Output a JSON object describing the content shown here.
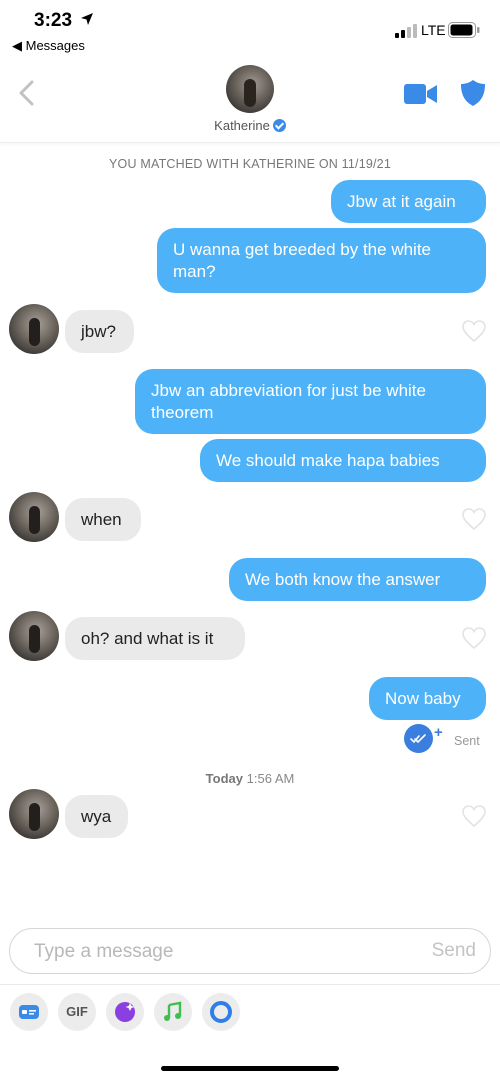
{
  "status_bar": {
    "time": "3:23",
    "back_app": "◀ Messages",
    "network": "LTE"
  },
  "header": {
    "name": "Katherine"
  },
  "matched_banner": "YOU MATCHED WITH KATHERINE ON 11/19/21",
  "messages": [
    {
      "text": "Jbw at it again"
    },
    {
      "text": "U wanna get breeded by the white man?"
    },
    {
      "text": "jbw?"
    },
    {
      "text": "Jbw an abbreviation for just be white theorem"
    },
    {
      "text": "We should make hapa babies"
    },
    {
      "text": "when"
    },
    {
      "text": "We both know the answer"
    },
    {
      "text": "oh? and what is it"
    },
    {
      "text": "Now baby"
    },
    {
      "text": "wya"
    }
  ],
  "receipt": {
    "plus": "+",
    "status": "Sent"
  },
  "timestamp": {
    "day": "Today",
    "time": "1:56 AM"
  },
  "composer": {
    "placeholder": "Type a message",
    "send_label": "Send"
  },
  "toolbar": {
    "gif_label": "GIF"
  },
  "colors": {
    "outgoing_bubble": "#4db2f7",
    "incoming_bubble": "#eaeaea",
    "accent_blue": "#3a8ae8"
  },
  "icons": [
    "location-arrow-icon",
    "signal-icon",
    "battery-icon",
    "back-chevron-icon",
    "verified-badge-icon",
    "video-camera-icon",
    "shield-icon",
    "heart-icon",
    "double-check-icon",
    "card-icon",
    "sticker-icon",
    "music-note-icon",
    "ring-icon"
  ]
}
